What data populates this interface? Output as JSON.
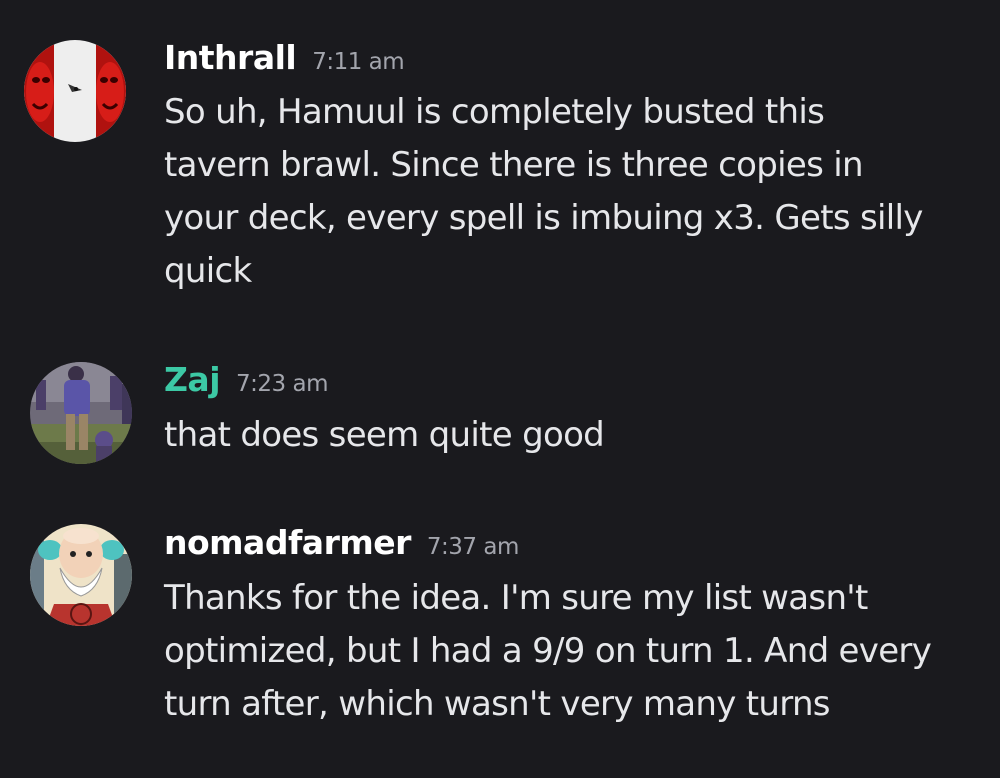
{
  "colors": {
    "background": "#1a1a1e",
    "username_default": "#ffffff",
    "username_zaj": "#3cc9a5",
    "timestamp": "#a3a5ad",
    "message_text": "#e6e7ea"
  },
  "messages": [
    {
      "username": "Inthrall",
      "timestamp": "7:11 am",
      "avatar_icon": "red-masks-avatar-icon",
      "lines": [
        "So uh, Hamuul is completely busted this",
        "tavern brawl. Since there is three copies in",
        "your deck, every spell is imbuing x3. Gets silly",
        "quick"
      ]
    },
    {
      "username": "Zaj",
      "timestamp": "7:23 am",
      "avatar_icon": "crowd-photo-avatar-icon",
      "lines": [
        "that does seem quite good"
      ]
    },
    {
      "username": "nomadfarmer",
      "timestamp": "7:37 am",
      "avatar_icon": "cartoon-professor-avatar-icon",
      "lines": [
        "Thanks for the idea. I'm sure my list wasn't",
        "optimized, but I had a 9/9 on turn 1. And every",
        "turn after, which wasn't very many turns"
      ]
    }
  ]
}
